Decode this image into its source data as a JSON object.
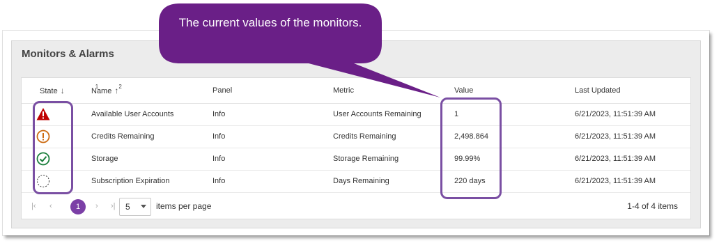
{
  "panel": {
    "title": "Monitors & Alarms"
  },
  "table": {
    "columns": {
      "state": "State",
      "state_sort_order": "1",
      "name": "Name",
      "name_sort_order": "2",
      "panel": "Panel",
      "metric": "Metric",
      "value": "Value",
      "last_updated": "Last Updated"
    },
    "rows": [
      {
        "state": "alarm-warning-icon",
        "name": "Available User Accounts",
        "panel": "Info",
        "metric": "User Accounts Remaining",
        "value": "1",
        "last_updated": "6/21/2023, 11:51:39 AM"
      },
      {
        "state": "caution-icon",
        "name": "Credits Remaining",
        "panel": "Info",
        "metric": "Credits Remaining",
        "value": "2,498.864",
        "last_updated": "6/21/2023, 11:51:39 AM"
      },
      {
        "state": "ok-check-icon",
        "name": "Storage",
        "panel": "Info",
        "metric": "Storage Remaining",
        "value": "99.99%",
        "last_updated": "6/21/2023, 11:51:39 AM"
      },
      {
        "state": "no-data-icon",
        "name": "Subscription Expiration",
        "panel": "Info",
        "metric": "Days Remaining",
        "value": "220 days",
        "last_updated": "6/21/2023, 11:51:39 AM"
      }
    ]
  },
  "pager": {
    "current_page": "1",
    "page_size": "5",
    "items_per_page_label": "items per page",
    "count_label": "1-4 of 4 items"
  },
  "callout": {
    "text": "The current values of the monitors."
  },
  "colors": {
    "accent": "#7b3fa6",
    "callout_fill": "#6a1f87",
    "alarm": "#c00000",
    "caution": "#cc6a10",
    "ok": "#1b7f3c"
  }
}
